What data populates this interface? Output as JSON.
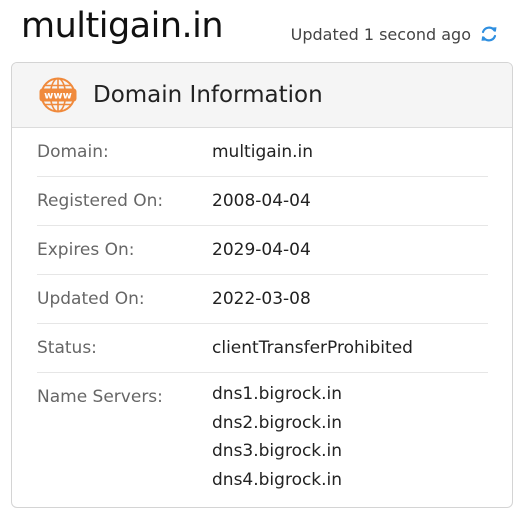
{
  "header": {
    "site_title": "multigain.in",
    "updated_text": "Updated 1 second ago"
  },
  "card": {
    "title": "Domain Information",
    "icon_text": "www",
    "rows": [
      {
        "label": "Domain:",
        "value": "multigain.in"
      },
      {
        "label": "Registered On:",
        "value": "2008-04-04"
      },
      {
        "label": "Expires On:",
        "value": "2029-04-04"
      },
      {
        "label": "Updated On:",
        "value": "2022-03-08"
      },
      {
        "label": "Status:",
        "value": "clientTransferProhibited"
      }
    ],
    "name_servers": {
      "label": "Name Servers:",
      "values": [
        "dns1.bigrock.in",
        "dns2.bigrock.in",
        "dns3.bigrock.in",
        "dns4.bigrock.in"
      ]
    }
  },
  "colors": {
    "icon_orange": "#f08a3c",
    "refresh_blue": "#2f8fe0"
  }
}
